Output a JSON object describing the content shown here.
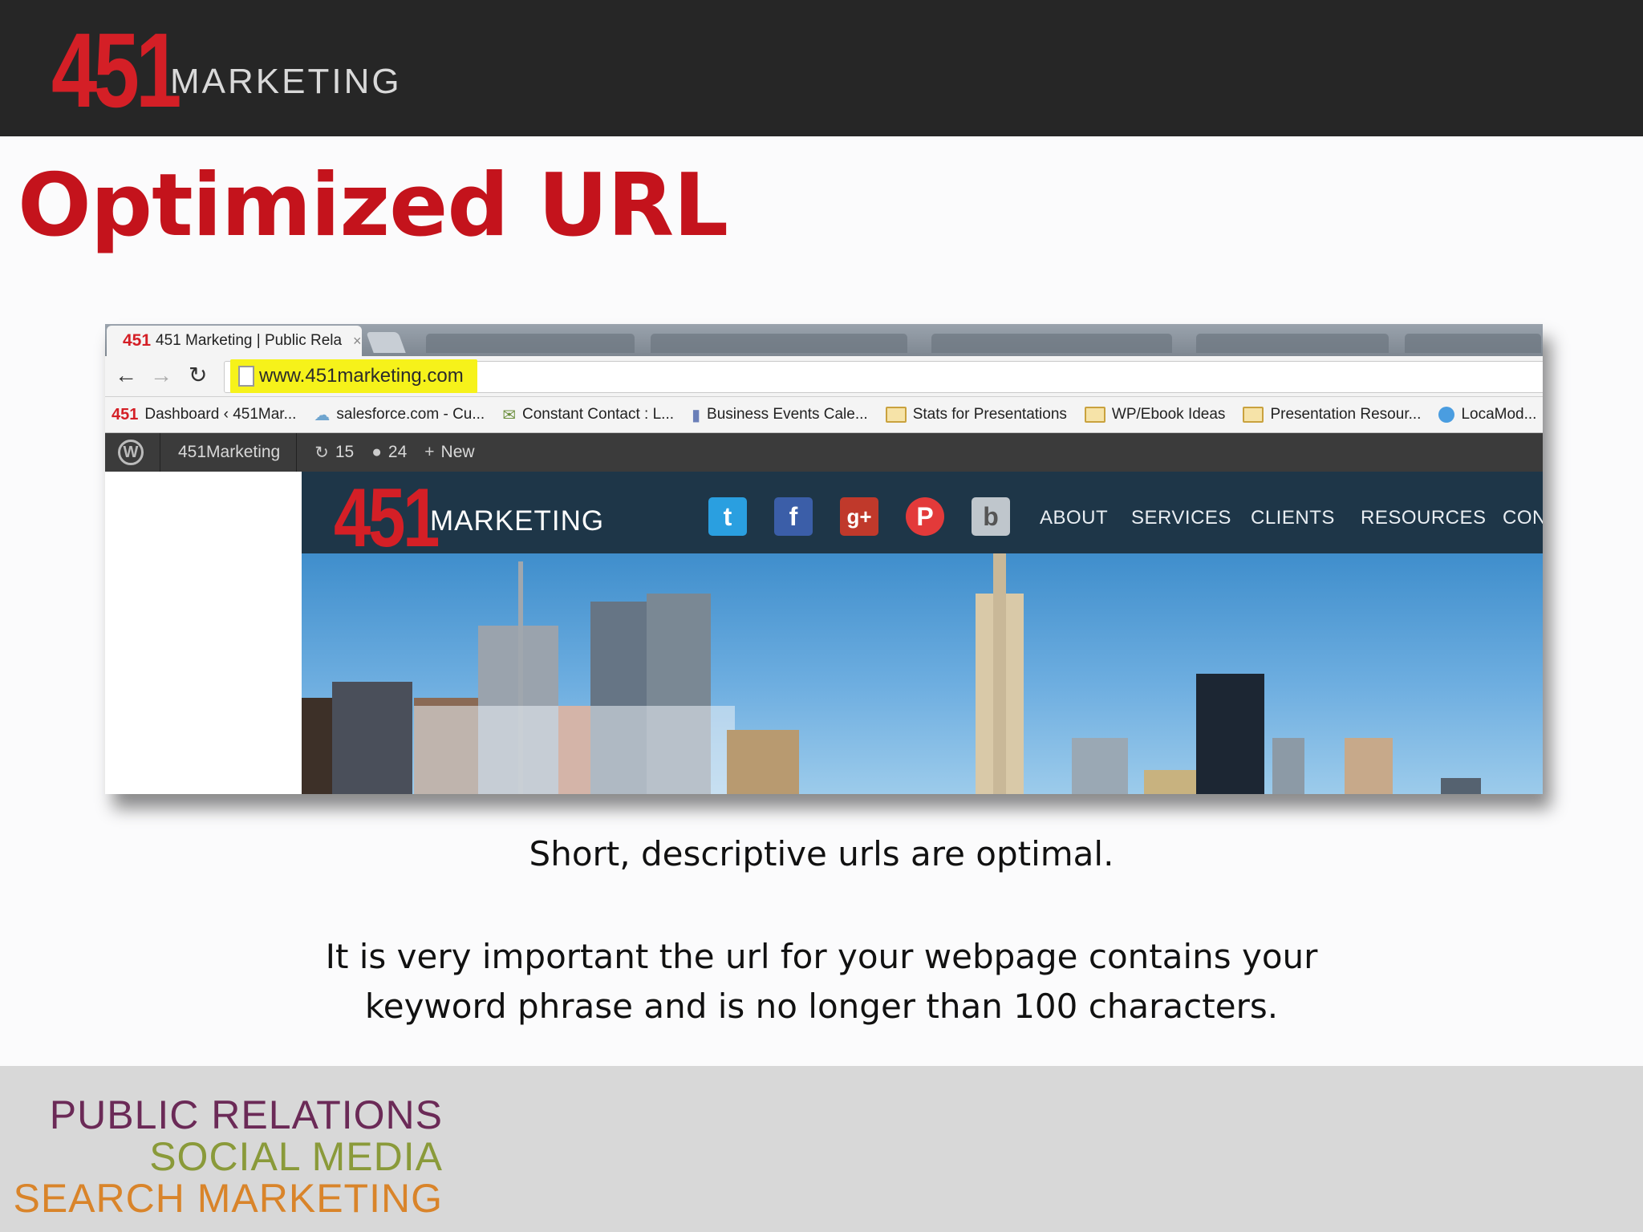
{
  "header": {
    "logo_number": "451",
    "logo_word": "MARKETING"
  },
  "slide": {
    "title": "Optimized URL",
    "caption_1": "Short, descriptive urls are optimal.",
    "caption_2_line1": "It is very important the url for your webpage contains your",
    "caption_2_line2": "keyword phrase and is no longer than 100 characters."
  },
  "browser": {
    "tab": {
      "favicon": "451",
      "title": "451 Marketing | Public Rela",
      "close": "×"
    },
    "nav": {
      "back": "←",
      "forward": "→",
      "reload": "↻"
    },
    "url": "www.451marketing.com",
    "bookmarks": [
      {
        "icon": "451",
        "label": "Dashboard ‹ 451Mar..."
      },
      {
        "icon": "cloud",
        "label": "salesforce.com - Cu..."
      },
      {
        "icon": "envelope",
        "label": "Constant Contact : L..."
      },
      {
        "icon": "calendar",
        "label": "Business Events Cale..."
      },
      {
        "icon": "folder",
        "label": "Stats for Presentations"
      },
      {
        "icon": "folder",
        "label": "WP/Ebook Ideas"
      },
      {
        "icon": "folder",
        "label": "Presentation Resour..."
      },
      {
        "icon": "globe",
        "label": "LocaMod..."
      }
    ]
  },
  "wp_admin_bar": {
    "site_name": "451Marketing",
    "updates_count": "15",
    "comments_count": "24",
    "new_label": "New"
  },
  "website": {
    "logo_number": "451",
    "logo_word": "MARKETING",
    "social": [
      "twitter",
      "facebook",
      "google-plus",
      "pinterest",
      "blogger"
    ],
    "social_glyphs": {
      "twitter": "t",
      "facebook": "f",
      "google": "g+",
      "pinterest": "P",
      "blogger": "b"
    },
    "menu": [
      "ABOUT",
      "SERVICES",
      "CLIENTS",
      "RESOURCES",
      "CONTACT US"
    ]
  },
  "footer": {
    "line1": "PUBLIC RELATIONS",
    "line2": "SOCIAL MEDIA",
    "line3": "SEARCH MARKETING",
    "colors": {
      "line1": "#6b2a57",
      "line2": "#8a9a3a",
      "line3": "#d9842a"
    }
  },
  "colors": {
    "brand_red": "#d41f26",
    "title_red": "#c4131c",
    "header_bg": "#262626",
    "url_highlight": "#f6f21a",
    "site_nav_bg": "#1e3648"
  }
}
